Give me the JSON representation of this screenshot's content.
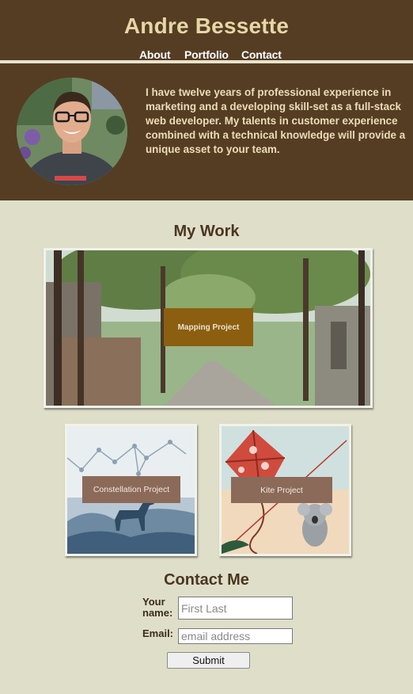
{
  "header": {
    "site_title": "Andre Bessette",
    "nav": {
      "about": "About",
      "portfolio": "Portfolio",
      "contact": "Contact"
    }
  },
  "hero": {
    "bio": "I have twelve years of professional experience in marketing and a developing skill-set as a full-stack web developer. My talents in customer experience combined with a technical knowledge will provide a unique asset to your team."
  },
  "work": {
    "title": "My Work",
    "projects": [
      {
        "label": "Mapping Project"
      },
      {
        "label": "Constellation Project"
      },
      {
        "label": "Kite Project"
      }
    ]
  },
  "contact": {
    "title": "Contact Me",
    "name_label": "Your name:",
    "name_placeholder": "First Last",
    "email_label": "Email:",
    "email_placeholder": "email address",
    "submit_label": "Submit"
  },
  "colors": {
    "header_bg": "#553d24",
    "page_bg": "#dedec9",
    "title_gold": "#e7d7a7",
    "label_box": "#8c5f10"
  }
}
